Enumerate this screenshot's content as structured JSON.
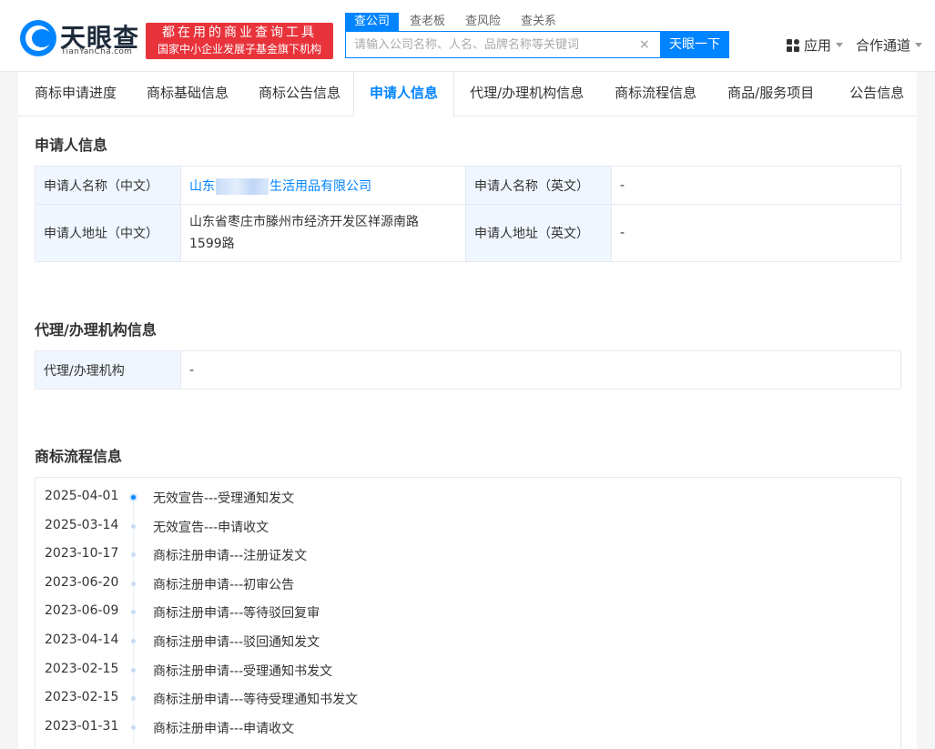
{
  "header": {
    "logo_text": "天眼查",
    "logo_sub": "TianYanCha.com",
    "slogan_line1": "都在用的商业查询工具",
    "slogan_line2": "国家中小企业发展子基金旗下机构",
    "search_tabs": [
      "查公司",
      "查老板",
      "查风险",
      "查关系"
    ],
    "search_placeholder": "请输入公司名称、人名、品牌名称等关键词",
    "search_button": "天眼一下",
    "clear_symbol": "×",
    "apps_label": "应用",
    "partner_label": "合作通道"
  },
  "subnav": {
    "items": [
      "商标申请进度",
      "商标基础信息",
      "商标公告信息",
      "申请人信息",
      "代理/办理机构信息",
      "商标流程信息",
      "商品/服务项目",
      "公告信息"
    ],
    "active_index": 3
  },
  "applicant": {
    "title": "申请人信息",
    "name_cn_label": "申请人名称（中文）",
    "name_cn_prefix": "山东",
    "name_cn_suffix": "生活用品有限公司",
    "name_en_label": "申请人名称（英文）",
    "name_en_value": "-",
    "addr_cn_label": "申请人地址（中文）",
    "addr_cn_line1": "山东省枣庄市滕州市经济开发区祥源南路",
    "addr_cn_line2": "1599路",
    "addr_en_label": "申请人地址（英文）",
    "addr_en_value": "-"
  },
  "agency": {
    "title": "代理/办理机构信息",
    "label": "代理/办理机构",
    "value": "-"
  },
  "flow": {
    "title": "商标流程信息",
    "rows": [
      {
        "date": "2025-04-01",
        "text": "无效宣告---受理通知发文"
      },
      {
        "date": "2025-03-14",
        "text": "无效宣告---申请收文"
      },
      {
        "date": "2023-10-17",
        "text": "商标注册申请---注册证发文"
      },
      {
        "date": "2023-06-20",
        "text": "商标注册申请---初审公告"
      },
      {
        "date": "2023-06-09",
        "text": "商标注册申请---等待驳回复审"
      },
      {
        "date": "2023-04-14",
        "text": "商标注册申请---驳回通知发文"
      },
      {
        "date": "2023-02-15",
        "text": "商标注册申请---受理通知书发文"
      },
      {
        "date": "2023-02-15",
        "text": "商标注册申请---等待受理通知书发文"
      },
      {
        "date": "2023-01-31",
        "text": "商标注册申请---申请收文"
      }
    ]
  },
  "colors": {
    "accent": "#0084ff",
    "slogan_red": "#e8333b",
    "label_bg": "#f0f6ff"
  }
}
